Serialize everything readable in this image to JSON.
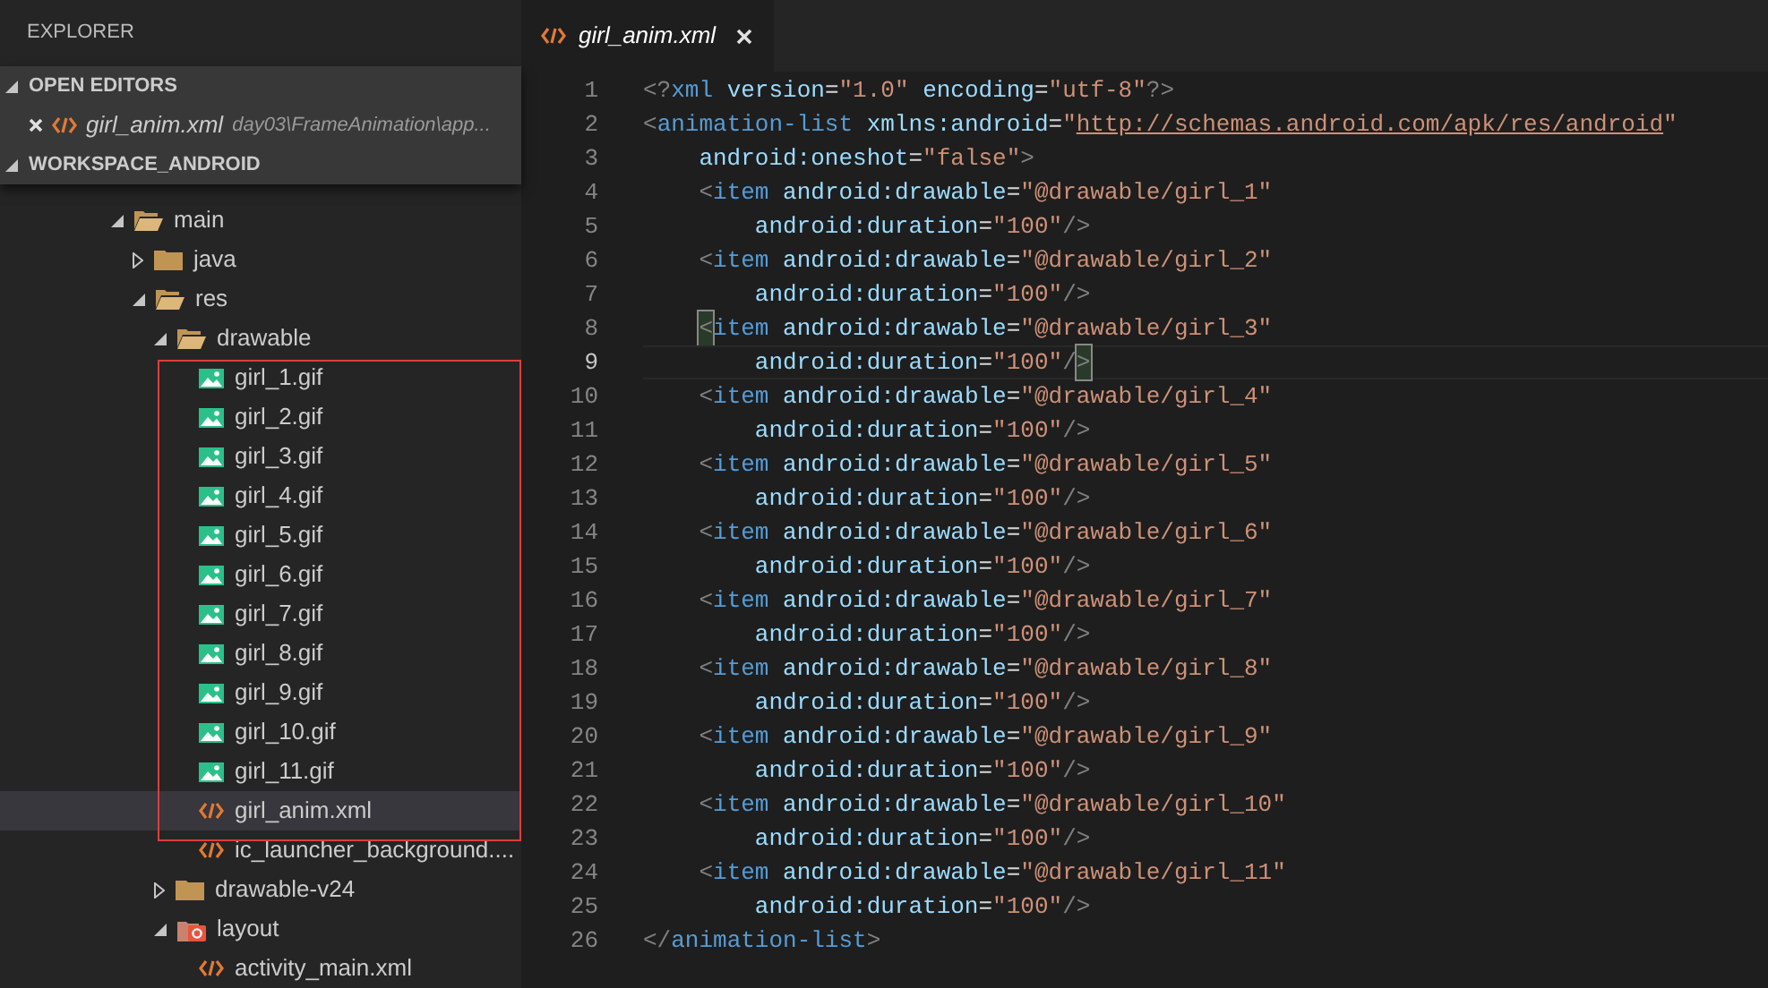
{
  "sidebar": {
    "title": "EXPLORER",
    "open_editors": {
      "title": "OPEN EDITORS",
      "expanded": true,
      "items": [
        {
          "name": "girl_anim.xml",
          "path": "day03\\FrameAnimation\\app...",
          "kind": "code"
        }
      ]
    },
    "workspace": {
      "title": "WORKSPACE_ANDROID",
      "expanded": true,
      "tree": [
        {
          "name": "main",
          "kind": "folder",
          "expanded": true,
          "selected": false,
          "children": [
            {
              "name": "java",
              "kind": "folder",
              "expanded": false,
              "selected": false
            },
            {
              "name": "res",
              "kind": "folder",
              "expanded": true,
              "selected": false,
              "children": [
                {
                  "name": "drawable",
                  "kind": "folder",
                  "expanded": true,
                  "selected": false,
                  "children": [
                    {
                      "name": "girl_1.gif",
                      "kind": "image",
                      "selected": false,
                      "boxed": true
                    },
                    {
                      "name": "girl_2.gif",
                      "kind": "image",
                      "selected": false,
                      "boxed": true
                    },
                    {
                      "name": "girl_3.gif",
                      "kind": "image",
                      "selected": false,
                      "boxed": true
                    },
                    {
                      "name": "girl_4.gif",
                      "kind": "image",
                      "selected": false,
                      "boxed": true
                    },
                    {
                      "name": "girl_5.gif",
                      "kind": "image",
                      "selected": false,
                      "boxed": true
                    },
                    {
                      "name": "girl_6.gif",
                      "kind": "image",
                      "selected": false,
                      "boxed": true
                    },
                    {
                      "name": "girl_7.gif",
                      "kind": "image",
                      "selected": false,
                      "boxed": true
                    },
                    {
                      "name": "girl_8.gif",
                      "kind": "image",
                      "selected": false,
                      "boxed": true
                    },
                    {
                      "name": "girl_9.gif",
                      "kind": "image",
                      "selected": false,
                      "boxed": true
                    },
                    {
                      "name": "girl_10.gif",
                      "kind": "image",
                      "selected": false,
                      "boxed": true
                    },
                    {
                      "name": "girl_11.gif",
                      "kind": "image",
                      "selected": false,
                      "boxed": true
                    },
                    {
                      "name": "girl_anim.xml",
                      "kind": "code",
                      "selected": true,
                      "boxed": true
                    },
                    {
                      "name": "ic_launcher_background....",
                      "kind": "code",
                      "selected": false,
                      "boxed": false
                    }
                  ]
                },
                {
                  "name": "drawable-v24",
                  "kind": "folder",
                  "expanded": false,
                  "selected": false
                },
                {
                  "name": "layout",
                  "kind": "layout_folder",
                  "expanded": true,
                  "selected": false,
                  "children": [
                    {
                      "name": "activity_main.xml",
                      "kind": "code",
                      "selected": false,
                      "boxed": false
                    }
                  ]
                }
              ]
            }
          ]
        }
      ]
    }
  },
  "tabs": [
    {
      "label": "girl_anim.xml",
      "kind": "code",
      "selected": true
    }
  ],
  "editor": {
    "lines": [
      {
        "number": "1",
        "current": false,
        "kind": "top",
        "tokens": [
          {
            "kind": "p",
            "text": "<?"
          },
          {
            "kind": "t",
            "text": "xml"
          },
          {
            "kind": "a",
            "text": " version"
          },
          {
            "kind": "e",
            "text": "="
          },
          {
            "kind": "s",
            "text": "\"1.0\""
          },
          {
            "kind": "a",
            "text": " encoding"
          },
          {
            "kind": "e",
            "text": "="
          },
          {
            "kind": "s",
            "text": "\"utf-8\""
          },
          {
            "kind": "p",
            "text": "?>"
          }
        ]
      },
      {
        "number": "2",
        "current": false,
        "kind": "top",
        "tokens": [
          {
            "kind": "p",
            "text": "<"
          },
          {
            "kind": "t",
            "text": "animation-list"
          },
          {
            "kind": "a",
            "text": " xmlns:android"
          },
          {
            "kind": "e",
            "text": "="
          },
          {
            "kind": "s",
            "text": "\""
          },
          {
            "kind": "u",
            "text": "http://schemas.android.com/apk/res/android"
          },
          {
            "kind": "s",
            "text": "\""
          }
        ]
      },
      {
        "number": "3",
        "current": false,
        "kind": "nested",
        "tokens": [
          {
            "kind": "a",
            "text": "android:oneshot"
          },
          {
            "kind": "e",
            "text": "="
          },
          {
            "kind": "s",
            "text": "\"false\""
          },
          {
            "kind": "p",
            "text": ">"
          }
        ]
      },
      {
        "number": "4",
        "current": false,
        "kind": "nested",
        "tokens": [
          {
            "kind": "p",
            "text": "<"
          },
          {
            "kind": "t",
            "text": "item"
          },
          {
            "kind": "a",
            "text": " android:drawable"
          },
          {
            "kind": "e",
            "text": "="
          },
          {
            "kind": "s",
            "text": "\"@drawable/girl_1\""
          }
        ]
      },
      {
        "number": "5",
        "current": false,
        "kind": "inner",
        "tokens": [
          {
            "kind": "a",
            "text": "android:duration"
          },
          {
            "kind": "e",
            "text": "="
          },
          {
            "kind": "s",
            "text": "\"100\""
          },
          {
            "kind": "p",
            "text": "/>"
          }
        ]
      },
      {
        "number": "6",
        "current": false,
        "kind": "nested",
        "tokens": [
          {
            "kind": "p",
            "text": "<"
          },
          {
            "kind": "t",
            "text": "item"
          },
          {
            "kind": "a",
            "text": " android:drawable"
          },
          {
            "kind": "e",
            "text": "="
          },
          {
            "kind": "s",
            "text": "\"@drawable/girl_2\""
          }
        ]
      },
      {
        "number": "7",
        "current": false,
        "kind": "inner",
        "tokens": [
          {
            "kind": "a",
            "text": "android:duration"
          },
          {
            "kind": "e",
            "text": "="
          },
          {
            "kind": "s",
            "text": "\"100\""
          },
          {
            "kind": "p",
            "text": "/>"
          }
        ]
      },
      {
        "number": "8",
        "current": false,
        "kind": "nested",
        "tokens": [
          {
            "kind": "m",
            "text": "<"
          },
          {
            "kind": "t",
            "text": "item"
          },
          {
            "kind": "a",
            "text": " android:drawable"
          },
          {
            "kind": "e",
            "text": "="
          },
          {
            "kind": "s",
            "text": "\"@drawable/girl_3\""
          }
        ]
      },
      {
        "number": "9",
        "current": true,
        "kind": "inner",
        "tokens": [
          {
            "kind": "a",
            "text": "android:duration"
          },
          {
            "kind": "e",
            "text": "="
          },
          {
            "kind": "s",
            "text": "\"100\""
          },
          {
            "kind": "p",
            "text": "/"
          },
          {
            "kind": "m",
            "text": ">"
          }
        ]
      },
      {
        "number": "10",
        "current": false,
        "kind": "nested",
        "tokens": [
          {
            "kind": "p",
            "text": "<"
          },
          {
            "kind": "t",
            "text": "item"
          },
          {
            "kind": "a",
            "text": " android:drawable"
          },
          {
            "kind": "e",
            "text": "="
          },
          {
            "kind": "s",
            "text": "\"@drawable/girl_4\""
          }
        ]
      },
      {
        "number": "11",
        "current": false,
        "kind": "inner",
        "tokens": [
          {
            "kind": "a",
            "text": "android:duration"
          },
          {
            "kind": "e",
            "text": "="
          },
          {
            "kind": "s",
            "text": "\"100\""
          },
          {
            "kind": "p",
            "text": "/>"
          }
        ]
      },
      {
        "number": "12",
        "current": false,
        "kind": "nested",
        "tokens": [
          {
            "kind": "p",
            "text": "<"
          },
          {
            "kind": "t",
            "text": "item"
          },
          {
            "kind": "a",
            "text": " android:drawable"
          },
          {
            "kind": "e",
            "text": "="
          },
          {
            "kind": "s",
            "text": "\"@drawable/girl_5\""
          }
        ]
      },
      {
        "number": "13",
        "current": false,
        "kind": "inner",
        "tokens": [
          {
            "kind": "a",
            "text": "android:duration"
          },
          {
            "kind": "e",
            "text": "="
          },
          {
            "kind": "s",
            "text": "\"100\""
          },
          {
            "kind": "p",
            "text": "/>"
          }
        ]
      },
      {
        "number": "14",
        "current": false,
        "kind": "nested",
        "tokens": [
          {
            "kind": "p",
            "text": "<"
          },
          {
            "kind": "t",
            "text": "item"
          },
          {
            "kind": "a",
            "text": " android:drawable"
          },
          {
            "kind": "e",
            "text": "="
          },
          {
            "kind": "s",
            "text": "\"@drawable/girl_6\""
          }
        ]
      },
      {
        "number": "15",
        "current": false,
        "kind": "inner",
        "tokens": [
          {
            "kind": "a",
            "text": "android:duration"
          },
          {
            "kind": "e",
            "text": "="
          },
          {
            "kind": "s",
            "text": "\"100\""
          },
          {
            "kind": "p",
            "text": "/>"
          }
        ]
      },
      {
        "number": "16",
        "current": false,
        "kind": "nested",
        "tokens": [
          {
            "kind": "p",
            "text": "<"
          },
          {
            "kind": "t",
            "text": "item"
          },
          {
            "kind": "a",
            "text": " android:drawable"
          },
          {
            "kind": "e",
            "text": "="
          },
          {
            "kind": "s",
            "text": "\"@drawable/girl_7\""
          }
        ]
      },
      {
        "number": "17",
        "current": false,
        "kind": "inner",
        "tokens": [
          {
            "kind": "a",
            "text": "android:duration"
          },
          {
            "kind": "e",
            "text": "="
          },
          {
            "kind": "s",
            "text": "\"100\""
          },
          {
            "kind": "p",
            "text": "/>"
          }
        ]
      },
      {
        "number": "18",
        "current": false,
        "kind": "nested",
        "tokens": [
          {
            "kind": "p",
            "text": "<"
          },
          {
            "kind": "t",
            "text": "item"
          },
          {
            "kind": "a",
            "text": " android:drawable"
          },
          {
            "kind": "e",
            "text": "="
          },
          {
            "kind": "s",
            "text": "\"@drawable/girl_8\""
          }
        ]
      },
      {
        "number": "19",
        "current": false,
        "kind": "inner",
        "tokens": [
          {
            "kind": "a",
            "text": "android:duration"
          },
          {
            "kind": "e",
            "text": "="
          },
          {
            "kind": "s",
            "text": "\"100\""
          },
          {
            "kind": "p",
            "text": "/>"
          }
        ]
      },
      {
        "number": "20",
        "current": false,
        "kind": "nested",
        "tokens": [
          {
            "kind": "p",
            "text": "<"
          },
          {
            "kind": "t",
            "text": "item"
          },
          {
            "kind": "a",
            "text": " android:drawable"
          },
          {
            "kind": "e",
            "text": "="
          },
          {
            "kind": "s",
            "text": "\"@drawable/girl_9\""
          }
        ]
      },
      {
        "number": "21",
        "current": false,
        "kind": "inner",
        "tokens": [
          {
            "kind": "a",
            "text": "android:duration"
          },
          {
            "kind": "e",
            "text": "="
          },
          {
            "kind": "s",
            "text": "\"100\""
          },
          {
            "kind": "p",
            "text": "/>"
          }
        ]
      },
      {
        "number": "22",
        "current": false,
        "kind": "nested",
        "tokens": [
          {
            "kind": "p",
            "text": "<"
          },
          {
            "kind": "t",
            "text": "item"
          },
          {
            "kind": "a",
            "text": " android:drawable"
          },
          {
            "kind": "e",
            "text": "="
          },
          {
            "kind": "s",
            "text": "\"@drawable/girl_10\""
          }
        ]
      },
      {
        "number": "23",
        "current": false,
        "kind": "inner",
        "tokens": [
          {
            "kind": "a",
            "text": "android:duration"
          },
          {
            "kind": "e",
            "text": "="
          },
          {
            "kind": "s",
            "text": "\"100\""
          },
          {
            "kind": "p",
            "text": "/>"
          }
        ]
      },
      {
        "number": "24",
        "current": false,
        "kind": "nested",
        "tokens": [
          {
            "kind": "p",
            "text": "<"
          },
          {
            "kind": "t",
            "text": "item"
          },
          {
            "kind": "a",
            "text": " android:drawable"
          },
          {
            "kind": "e",
            "text": "="
          },
          {
            "kind": "s",
            "text": "\"@drawable/girl_11\""
          }
        ]
      },
      {
        "number": "25",
        "current": false,
        "kind": "inner",
        "tokens": [
          {
            "kind": "a",
            "text": "android:duration"
          },
          {
            "kind": "e",
            "text": "="
          },
          {
            "kind": "s",
            "text": "\"100\""
          },
          {
            "kind": "p",
            "text": "/>"
          }
        ]
      },
      {
        "number": "26",
        "current": false,
        "kind": "top",
        "tokens": [
          {
            "kind": "p",
            "text": "</"
          },
          {
            "kind": "t",
            "text": "animation-list"
          },
          {
            "kind": "p",
            "text": ">"
          }
        ]
      }
    ]
  }
}
